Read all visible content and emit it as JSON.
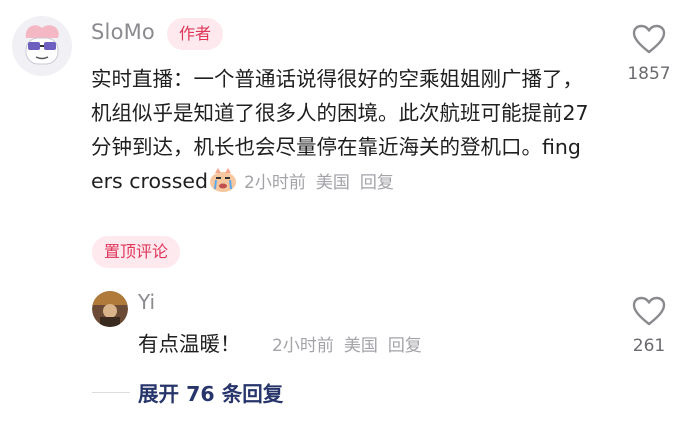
{
  "comment": {
    "username": "SloMo",
    "author_badge": "作者",
    "text": "实时直播：一个普通话说得很好的空乘姐姐刚广播了，机组似乎是知道了很多人的困境。此次航班可能提前27分钟到达，机长也会尽量停在靠近海关的登机口。fingers crossed",
    "emoji_icon": "crying-emoji-icon",
    "time": "2小时前",
    "location": "美国",
    "reply_label": "回复",
    "pin_badge": "置顶评论",
    "likes": "1857"
  },
  "reply": {
    "username": "Yi",
    "text": "有点温暖！",
    "time": "2小时前",
    "location": "美国",
    "reply_label": "回复",
    "likes": "261"
  },
  "expand_replies": "展开 76 条回复",
  "colors": {
    "accent_pink": "#e0365a",
    "badge_bg": "#fde9ee",
    "muted": "#a3a3a8",
    "link_dark": "#27356b"
  }
}
